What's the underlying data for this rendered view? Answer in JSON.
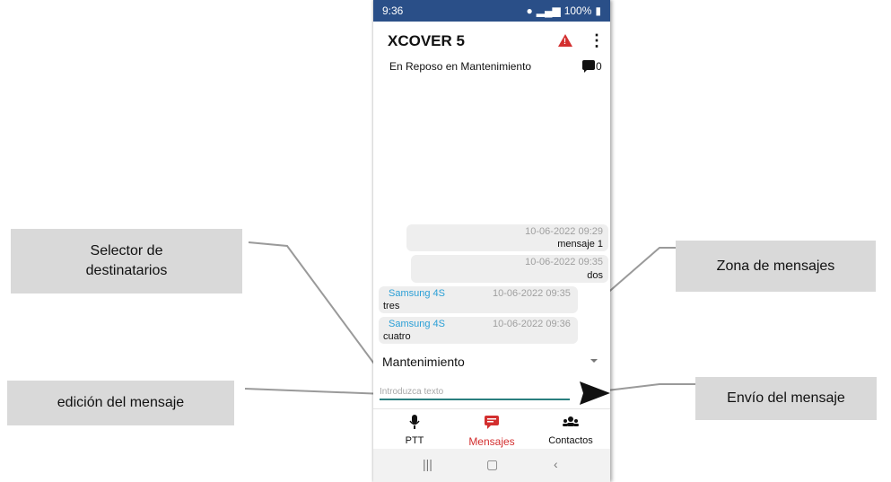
{
  "callouts": {
    "selector": "Selector de\ndestinatarios",
    "zona": "Zona de mensajes",
    "edicion": "edición del mensaje",
    "envio": "Envío del mensaje"
  },
  "phone": {
    "status": {
      "time": "9:36",
      "battery": "100%"
    },
    "title": "XCOVER 5",
    "state": "En Reposo en Mantenimiento",
    "message_count": "0",
    "messages": [
      {
        "sender": "",
        "date": "10-06-2022 09:29",
        "text": "mensaje 1",
        "outgoing": true
      },
      {
        "sender": "",
        "date": "10-06-2022 09:35",
        "text": "dos",
        "outgoing": true
      },
      {
        "sender": "Samsung 4S",
        "date": "10-06-2022 09:35",
        "text": "tres",
        "outgoing": false
      },
      {
        "sender": "Samsung 4S",
        "date": "10-06-2022 09:36",
        "text": "cuatro",
        "outgoing": false
      }
    ],
    "recipient": "Mantenimiento",
    "input_placeholder": "Introduzca texto",
    "nav": [
      {
        "label": "PTT",
        "icon": "microphone-icon",
        "active": false
      },
      {
        "label": "Mensajes",
        "icon": "message-icon",
        "active": true
      },
      {
        "label": "Contactos",
        "icon": "contacts-icon",
        "active": false
      }
    ],
    "colors": {
      "status_bar": "#2a4f88",
      "accent": "#d32f2f",
      "sender": "#2a9fd6",
      "input_line": "#2a7f7f"
    }
  }
}
